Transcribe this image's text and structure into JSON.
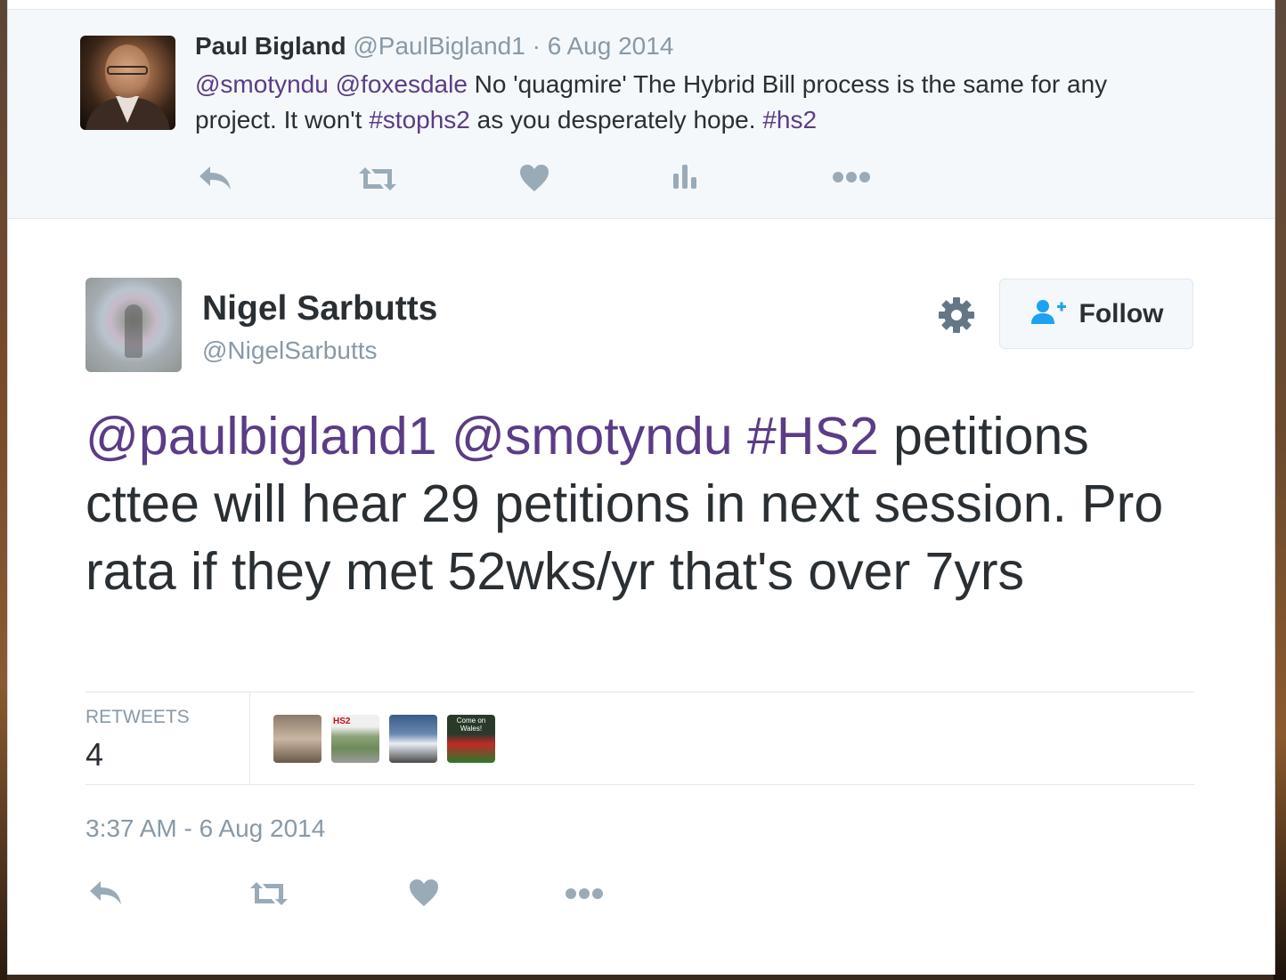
{
  "previous_tweet": {
    "name": "Paul Bigland",
    "handle": "@PaulBigland1",
    "separator": "·",
    "date": "6 Aug 2014",
    "text_parts": [
      {
        "text": "@smotyndu",
        "link": true
      },
      {
        "text": " ",
        "link": false
      },
      {
        "text": "@foxesdale",
        "link": true
      },
      {
        "text": " No 'quagmire' The Hybrid Bill process is the same for any project. It won't ",
        "link": false
      },
      {
        "text": "#stophs2",
        "link": true
      },
      {
        "text": " as you desperately hope. ",
        "link": false
      },
      {
        "text": "#hs2",
        "link": true
      }
    ],
    "actions": [
      "reply-icon",
      "retweet-icon",
      "like-icon",
      "analytics-icon",
      "more-icon"
    ]
  },
  "tweet": {
    "name": "Nigel Sarbutts",
    "handle": "@NigelSarbutts",
    "follow_label": "Follow",
    "text_parts": [
      {
        "text": "@paulbigland1",
        "link": true
      },
      {
        "text": " ",
        "link": false
      },
      {
        "text": "@smotyndu",
        "link": true
      },
      {
        "text": " ",
        "link": false
      },
      {
        "text": "#HS2",
        "link": true
      },
      {
        "text": " petitions cttee will hear 29 petitions in next session. Pro rata if they met 52wks/yr that's over 7yrs",
        "link": false
      }
    ],
    "stats": {
      "retweets_label": "RETWEETS",
      "retweets_count": "4",
      "retweeter_count_shown": 4
    },
    "retweeter_thumbs": {
      "rt2_logo": "HS2",
      "rt4_caption": "Come on Wales!"
    },
    "timestamp": "3:37 AM - 6 Aug 2014",
    "actions": [
      "reply-icon",
      "retweet-icon",
      "like-icon",
      "more-icon"
    ]
  },
  "colors": {
    "link": "#5b3c86",
    "text": "#292f33",
    "muted": "#8899a6",
    "icon": "#9aabb8",
    "panel": "#f5f8fa"
  }
}
